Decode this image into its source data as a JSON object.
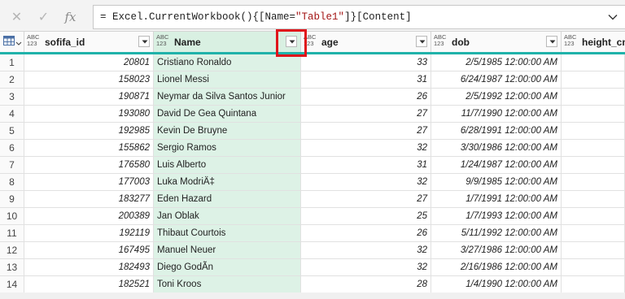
{
  "formula_bar": {
    "cancel_icon": "close-icon",
    "confirm_icon": "check-icon",
    "fx_label": "fx",
    "formula_prefix": "= Excel.CurrentWorkbook(){[Name=",
    "formula_string": "\"Table1\"",
    "formula_suffix": "]}[Content]"
  },
  "table": {
    "type_icon_top": "ABC",
    "type_icon_bottom": "123",
    "columns": [
      {
        "label": "sofifa_id"
      },
      {
        "label": "Name"
      },
      {
        "label": "age"
      },
      {
        "label": "dob"
      },
      {
        "label": "height_cm"
      }
    ],
    "rows": [
      {
        "idx": "1",
        "sofifa_id": "20801",
        "name": "Cristiano Ronaldo",
        "age": "33",
        "dob": "2/5/1985 12:00:00 AM"
      },
      {
        "idx": "2",
        "sofifa_id": "158023",
        "name": "Lionel Messi",
        "age": "31",
        "dob": "6/24/1987 12:00:00 AM"
      },
      {
        "idx": "3",
        "sofifa_id": "190871",
        "name": "Neymar da Silva Santos Junior",
        "age": "26",
        "dob": "2/5/1992 12:00:00 AM"
      },
      {
        "idx": "4",
        "sofifa_id": "193080",
        "name": "David De Gea Quintana",
        "age": "27",
        "dob": "11/7/1990 12:00:00 AM"
      },
      {
        "idx": "5",
        "sofifa_id": "192985",
        "name": "Kevin De Bruyne",
        "age": "27",
        "dob": "6/28/1991 12:00:00 AM"
      },
      {
        "idx": "6",
        "sofifa_id": "155862",
        "name": "Sergio Ramos",
        "age": "32",
        "dob": "3/30/1986 12:00:00 AM"
      },
      {
        "idx": "7",
        "sofifa_id": "176580",
        "name": "Luis Alberto",
        "age": "31",
        "dob": "1/24/1987 12:00:00 AM"
      },
      {
        "idx": "8",
        "sofifa_id": "177003",
        "name": "Luka ModriÄ‡",
        "age": "32",
        "dob": "9/9/1985 12:00:00 AM"
      },
      {
        "idx": "9",
        "sofifa_id": "183277",
        "name": "Eden Hazard",
        "age": "27",
        "dob": "1/7/1991 12:00:00 AM"
      },
      {
        "idx": "10",
        "sofifa_id": "200389",
        "name": "Jan Oblak",
        "age": "25",
        "dob": "1/7/1993 12:00:00 AM"
      },
      {
        "idx": "11",
        "sofifa_id": "192119",
        "name": "Thibaut Courtois",
        "age": "26",
        "dob": "5/11/1992 12:00:00 AM"
      },
      {
        "idx": "12",
        "sofifa_id": "167495",
        "name": "Manuel Neuer",
        "age": "32",
        "dob": "3/27/1986 12:00:00 AM"
      },
      {
        "idx": "13",
        "sofifa_id": "182493",
        "name": "Diego GodÃn",
        "age": "32",
        "dob": "2/16/1986 12:00:00 AM"
      },
      {
        "idx": "14",
        "sofifa_id": "182521",
        "name": "Toni Kroos",
        "age": "28",
        "dob": "1/4/1990 12:00:00 AM"
      }
    ]
  },
  "colors": {
    "accent_teal": "#20b2aa",
    "selected_column": "#ddf2e6",
    "highlight_box": "#e0151b"
  }
}
